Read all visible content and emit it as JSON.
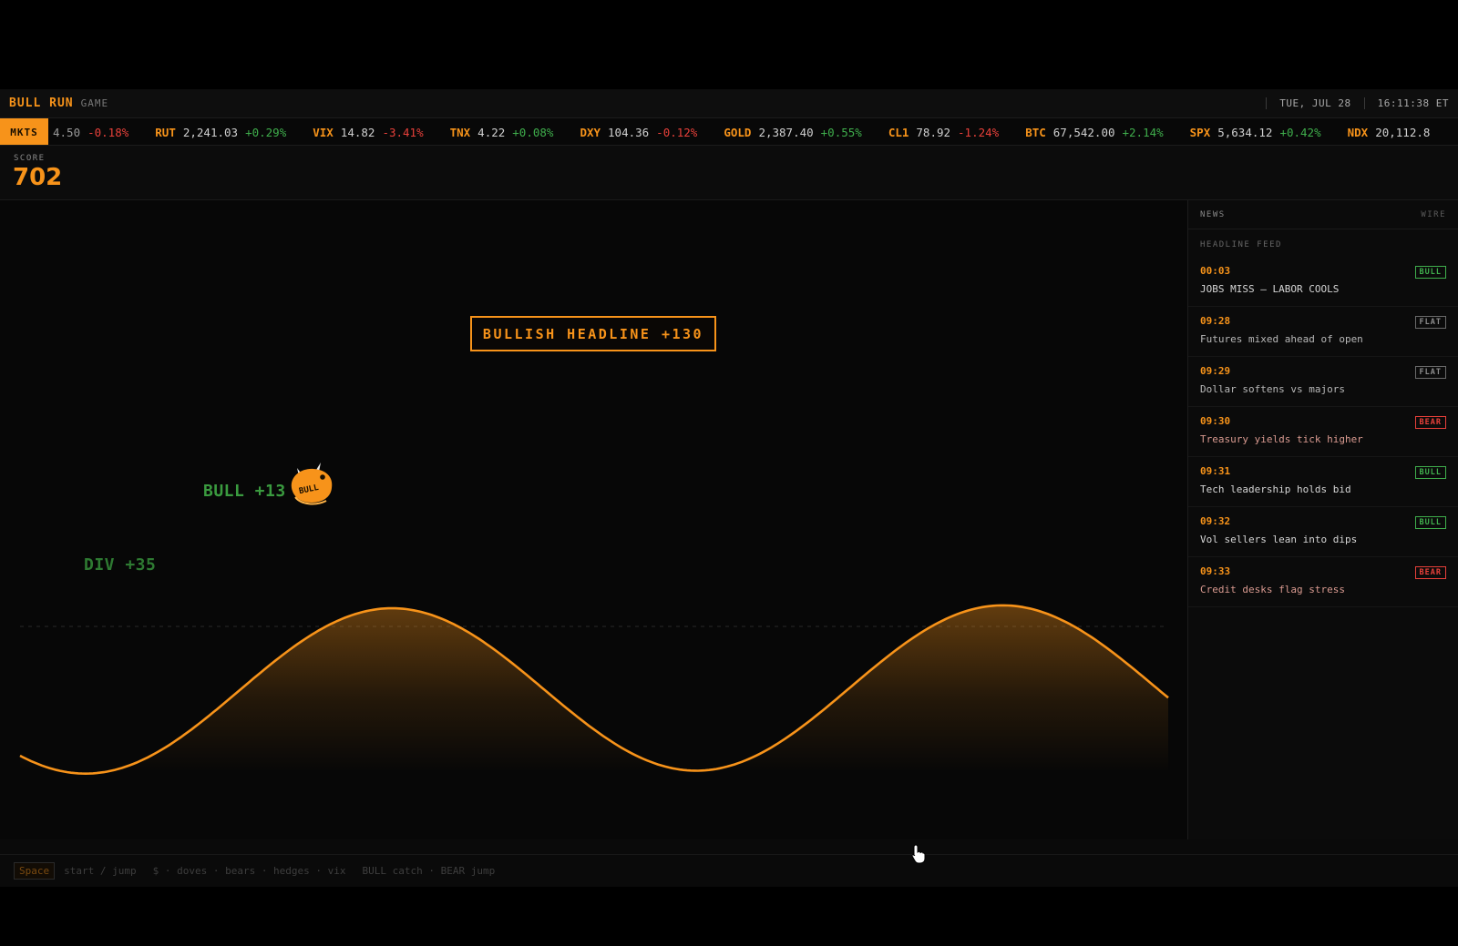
{
  "header": {
    "brand": "BULL RUN",
    "brand_sub": "GAME",
    "date": "TUE, JUL 28",
    "time": "16:11:38 ET"
  },
  "ticker": {
    "label": "MKTS",
    "partial_start": {
      "price": "4.50",
      "change": "-0.18%"
    },
    "items": [
      {
        "sym": "RUT",
        "price": "2,241.03",
        "change": "+0.29%",
        "dir": "up"
      },
      {
        "sym": "VIX",
        "price": "14.82",
        "change": "-3.41%",
        "dir": "dn"
      },
      {
        "sym": "TNX",
        "price": "4.22",
        "change": "+0.08%",
        "dir": "up"
      },
      {
        "sym": "DXY",
        "price": "104.36",
        "change": "-0.12%",
        "dir": "dn"
      },
      {
        "sym": "GOLD",
        "price": "2,387.40",
        "change": "+0.55%",
        "dir": "up"
      },
      {
        "sym": "CL1",
        "price": "78.92",
        "change": "-1.24%",
        "dir": "dn"
      },
      {
        "sym": "BTC",
        "price": "67,542.00",
        "change": "+2.14%",
        "dir": "up"
      },
      {
        "sym": "SPX",
        "price": "5,634.12",
        "change": "+0.42%",
        "dir": "up"
      },
      {
        "sym": "NDX",
        "price": "20,112.8",
        "change": "",
        "dir": "up"
      }
    ]
  },
  "score": {
    "label": "SCORE",
    "value": "702"
  },
  "game": {
    "banner": "BULLISH HEADLINE +130",
    "float_bull": "BULL +13",
    "float_div": "DIV +35",
    "sprite_label": "BULL",
    "accent": "#f7931a"
  },
  "news": {
    "title": "NEWS",
    "right": "WIRE",
    "feed_label": "HEADLINE FEED",
    "items": [
      {
        "time": "00:03",
        "headline": "JOBS MISS — LABOR COOLS",
        "tag": "BULL",
        "kind": "bull"
      },
      {
        "time": "09:28",
        "headline": "Futures mixed ahead of open",
        "tag": "FLAT",
        "kind": "flat"
      },
      {
        "time": "09:29",
        "headline": "Dollar softens vs majors",
        "tag": "FLAT",
        "kind": "flat"
      },
      {
        "time": "09:30",
        "headline": "Treasury yields tick higher",
        "tag": "BEAR",
        "kind": "bear"
      },
      {
        "time": "09:31",
        "headline": "Tech leadership holds bid",
        "tag": "BULL",
        "kind": "bull"
      },
      {
        "time": "09:32",
        "headline": "Vol sellers lean into dips",
        "tag": "BULL",
        "kind": "bull"
      },
      {
        "time": "09:33",
        "headline": "Credit desks flag stress",
        "tag": "BEAR",
        "kind": "bear"
      }
    ]
  },
  "footer": {
    "key": "Space",
    "hint1": "start / jump",
    "hint2": "$ · doves · bears · hedges · vix",
    "hint3": "BULL catch · BEAR jump"
  }
}
